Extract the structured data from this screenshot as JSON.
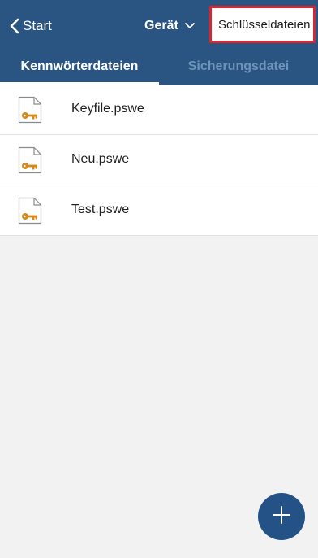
{
  "nav": {
    "back_label": "Start",
    "device_label": "Gerät",
    "keyfiles_label": "Schlüsseldateien"
  },
  "tabs": [
    {
      "label": "Kennwörterdateien",
      "selected": true
    },
    {
      "label": "Sicherungsdatei",
      "selected": false
    }
  ],
  "files": [
    {
      "name": "Keyfile.pswe",
      "icon": "key-file-icon"
    },
    {
      "name": "Neu.pswe",
      "icon": "key-file-icon"
    },
    {
      "name": "Test.pswe",
      "icon": "key-file-icon"
    }
  ],
  "fab": {
    "icon": "plus-icon"
  },
  "colors": {
    "header": "#2a5583",
    "accent": "#245186",
    "highlight_border": "#d9252f",
    "key_icon": "#d6881c"
  }
}
